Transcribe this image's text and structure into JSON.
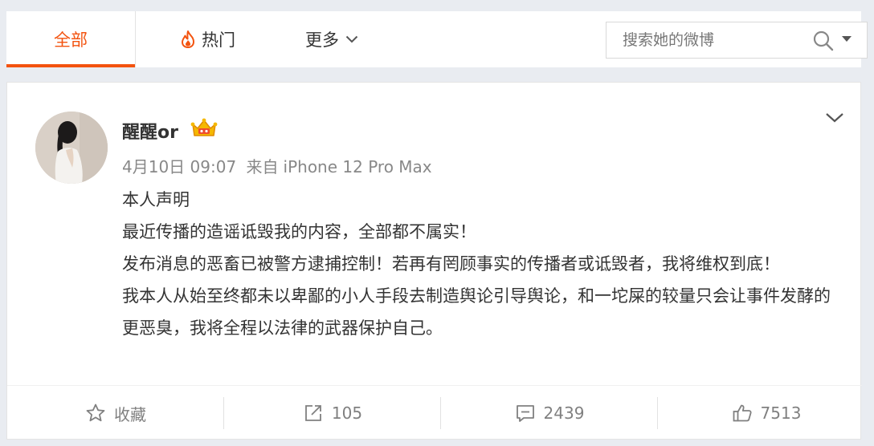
{
  "tabs": {
    "all": "全部",
    "hot": "热门",
    "more": "更多"
  },
  "search": {
    "placeholder": "搜索她的微博"
  },
  "post": {
    "username": "醒醒or",
    "date": "4月10日 09:07",
    "source_prefix": "来自",
    "source": "iPhone 12 Pro Max",
    "lines": [
      "本人声明",
      "最近传播的造谣诋毁我的内容，全部都不属实！",
      "发布消息的恶畜已被警方逮捕控制！若再有罔顾事实的传播者或诋毁者，我将维权到底！",
      "我本人从始至终都未以卑鄙的小人手段去制造舆论引导舆论，和一坨屎的较量只会让事件发酵的更恶臭，我将全程以法律的武器保护自己。"
    ]
  },
  "actions": {
    "favorite_label": "收藏",
    "forward_count": "105",
    "comment_count": "2439",
    "like_count": "7513"
  },
  "colors": {
    "accent": "#f3530f",
    "background": "#e9ecf1",
    "muted_text": "#808080",
    "crown_gold": "#f5b800"
  },
  "icons": {
    "hot": "flame-icon",
    "more": "chevron-down-icon",
    "search": "search-icon",
    "favorite": "star-icon",
    "forward": "share-arrow-icon",
    "comment": "comment-icon",
    "like": "thumbs-up-icon",
    "badge": "crown-icon"
  }
}
